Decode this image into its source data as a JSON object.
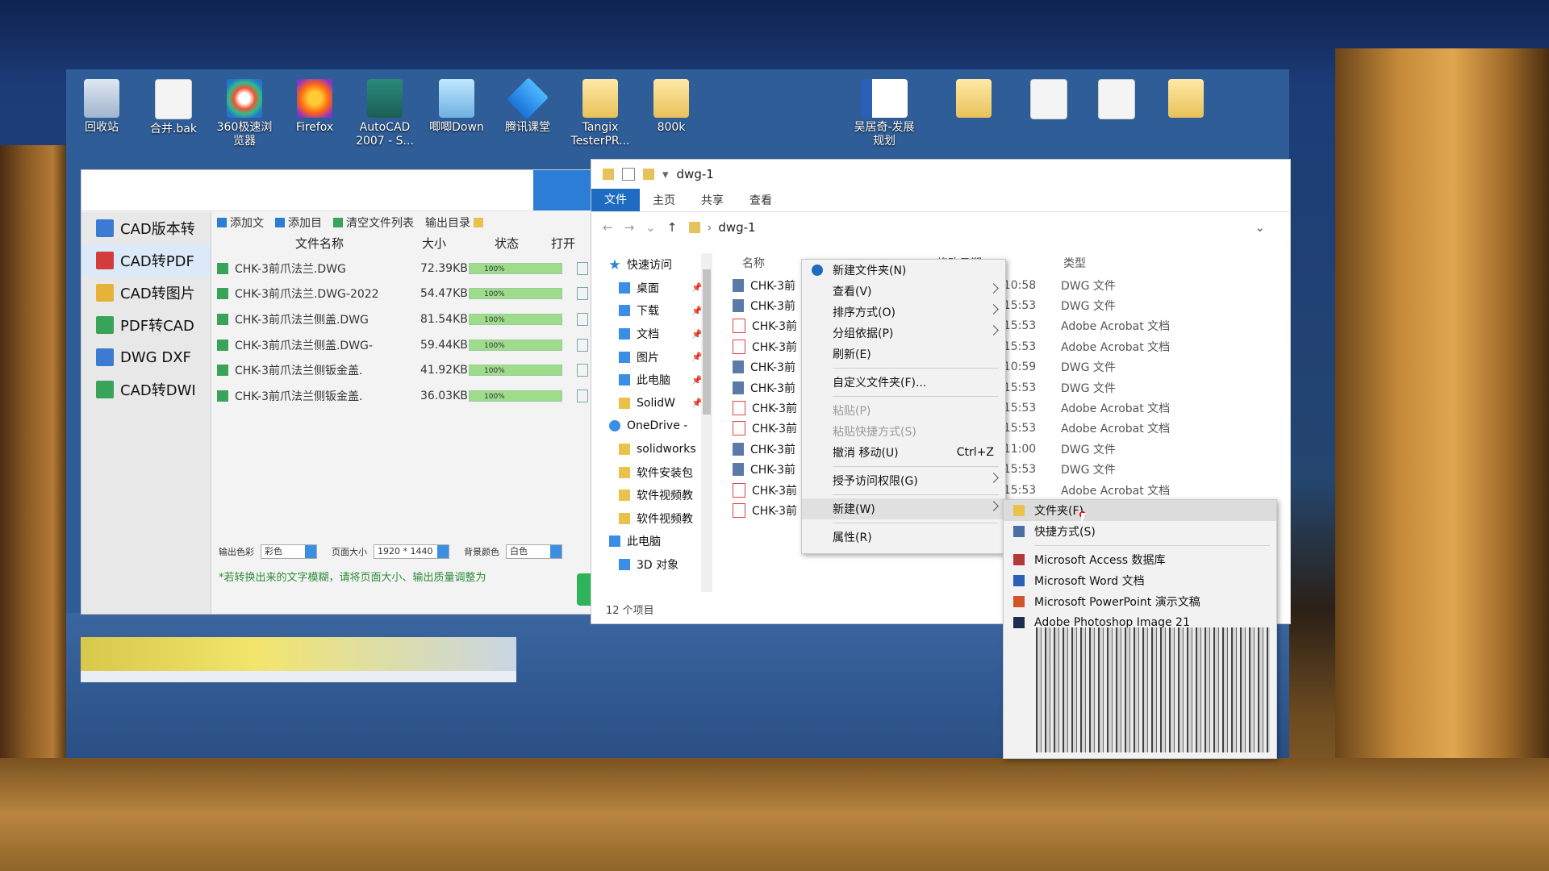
{
  "desktop": {
    "icons": [
      {
        "label": "回收站",
        "icon": "recycle-bin-icon"
      },
      {
        "label": "合并.bak",
        "icon": "file-icon"
      },
      {
        "label": "360极速浏览器",
        "icon": "browser-360-icon"
      },
      {
        "label": "Firefox",
        "icon": "firefox-icon"
      },
      {
        "label": "AutoCAD 2007 - S...",
        "icon": "autocad-icon"
      },
      {
        "label": "唧唧Down",
        "icon": "jijidown-icon"
      },
      {
        "label": "腾讯课堂",
        "icon": "tencent-classroom-icon"
      },
      {
        "label": "Tangix TesterPR...",
        "icon": "folder-icon"
      },
      {
        "label": "800k",
        "icon": "folder-icon"
      },
      {
        "label": "吴居奇-发展规划",
        "icon": "word-doc-icon"
      }
    ]
  },
  "cad_app": {
    "sidebar": [
      "CAD版本转",
      "CAD转PDF",
      "CAD转图片",
      "PDF转CAD",
      "DWG DXF",
      "CAD转DWI"
    ],
    "toolbar": {
      "add_file": "添加文",
      "add_dir": "添加目",
      "clear_list": "清空文件列表",
      "output_dir": "输出目录"
    },
    "columns": {
      "name": "文件名称",
      "size": "大小",
      "status": "状态",
      "open": "打开"
    },
    "files": [
      {
        "name": "CHK-3前爪法兰.DWG",
        "size": "72.39KB",
        "progress": "100%"
      },
      {
        "name": "CHK-3前爪法兰.DWG-2022",
        "size": "54.47KB",
        "progress": "100%"
      },
      {
        "name": "CHK-3前爪法兰侧盖.DWG",
        "size": "81.54KB",
        "progress": "100%"
      },
      {
        "name": "CHK-3前爪法兰侧盖.DWG-",
        "size": "59.44KB",
        "progress": "100%"
      },
      {
        "name": "CHK-3前爪法兰侧钣金盖.",
        "size": "41.92KB",
        "progress": "100%"
      },
      {
        "name": "CHK-3前爪法兰侧钣金盖.",
        "size": "36.03KB",
        "progress": "100%"
      }
    ],
    "options": {
      "color_label": "输出色彩",
      "color_value": "彩色",
      "page_label": "页面大小",
      "page_value": "1920 * 1440",
      "bg_label": "背景颜色",
      "bg_value": "白色"
    },
    "note": "*若转换出来的文字模糊，请将页面大小、输出质量调整为"
  },
  "explorer": {
    "title": "dwg-1",
    "tabs": [
      "文件",
      "主页",
      "共享",
      "查看"
    ],
    "path": "dwg-1",
    "nav": [
      {
        "label": "快速访问",
        "icon": "star"
      },
      {
        "label": "桌面",
        "icon": "blue",
        "pin": "📌"
      },
      {
        "label": "下载",
        "icon": "blue",
        "pin": "📌"
      },
      {
        "label": "文档",
        "icon": "blue",
        "pin": "📌"
      },
      {
        "label": "图片",
        "icon": "blue",
        "pin": "📌"
      },
      {
        "label": "此电脑",
        "icon": "blue",
        "pin": "📌"
      },
      {
        "label": "SolidW",
        "icon": "yf",
        "pin": "📌"
      },
      {
        "label": "OneDrive -",
        "icon": "cloud"
      },
      {
        "label": "solidworks",
        "icon": "yf"
      },
      {
        "label": "软件安装包",
        "icon": "yf"
      },
      {
        "label": "软件视频教",
        "icon": "yf"
      },
      {
        "label": "软件视频教",
        "icon": "yf"
      },
      {
        "label": "此电脑",
        "icon": "blue"
      },
      {
        "label": "3D 对象",
        "icon": "blue"
      }
    ],
    "columns": {
      "name": "名称",
      "date": "修改日期",
      "type": "类型"
    },
    "files": [
      {
        "name": "CHK-3前",
        "date": "2022-06-28 10:58",
        "type": "DWG 文件",
        "kind": "dwg"
      },
      {
        "name": "CHK-3前",
        "date": "2022-06-28 15:53",
        "type": "DWG 文件",
        "kind": "dwg"
      },
      {
        "name": "CHK-3前",
        "date": "2022-06-28 15:53",
        "type": "Adobe Acrobat 文档",
        "kind": "pdf"
      },
      {
        "name": "CHK-3前",
        "date": "2022-06-28 15:53",
        "type": "Adobe Acrobat 文档",
        "kind": "pdf"
      },
      {
        "name": "CHK-3前",
        "date": "2022-06-28 10:59",
        "type": "DWG 文件",
        "kind": "dwg"
      },
      {
        "name": "CHK-3前",
        "date": "2022-06-28 15:53",
        "type": "DWG 文件",
        "kind": "dwg"
      },
      {
        "name": "CHK-3前",
        "date": "2022-06-28 15:53",
        "type": "Adobe Acrobat 文档",
        "kind": "pdf"
      },
      {
        "name": "CHK-3前",
        "date": "2022-06-28 15:53",
        "type": "Adobe Acrobat 文档",
        "kind": "pdf"
      },
      {
        "name": "CHK-3前",
        "date": "2022-06-28 11:00",
        "type": "DWG 文件",
        "kind": "dwg"
      },
      {
        "name": "CHK-3前",
        "date": "2022-06-28 15:53",
        "type": "DWG 文件",
        "kind": "dwg"
      },
      {
        "name": "CHK-3前",
        "date": "2022-06-28 15:53",
        "type": "Adobe Acrobat 文档",
        "kind": "pdf"
      },
      {
        "name": "CHK-3前",
        "date": "",
        "type": "",
        "kind": "pdf"
      }
    ],
    "status": "12 个项目"
  },
  "context_menu": {
    "items": [
      {
        "label": "新建文件夹(N)",
        "icon": true
      },
      {
        "label": "查看(V)",
        "arrow": true
      },
      {
        "label": "排序方式(O)",
        "arrow": true
      },
      {
        "label": "分组依据(P)",
        "arrow": true
      },
      {
        "label": "刷新(E)"
      },
      {
        "sep": true
      },
      {
        "label": "自定义文件夹(F)..."
      },
      {
        "sep": true
      },
      {
        "label": "粘贴(P)",
        "disabled": true
      },
      {
        "label": "粘贴快捷方式(S)",
        "disabled": true
      },
      {
        "label": "撤消 移动(U)",
        "shortcut": "Ctrl+Z"
      },
      {
        "sep": true
      },
      {
        "label": "授予访问权限(G)",
        "arrow": true
      },
      {
        "sep": true
      },
      {
        "label": "新建(W)",
        "arrow": true,
        "highlight": true
      },
      {
        "sep": true
      },
      {
        "label": "属性(R)"
      }
    ]
  },
  "submenu": {
    "items": [
      {
        "label": "文件夹(F)",
        "icon": "fold",
        "highlight": true
      },
      {
        "label": "快捷方式(S)",
        "icon": "lnk"
      },
      {
        "sep": true
      },
      {
        "label": "Microsoft Access 数据库",
        "icon": "acc"
      },
      {
        "label": "Microsoft Word 文档",
        "icon": "wrd"
      },
      {
        "label": "Microsoft PowerPoint 演示文稿",
        "icon": "ppt"
      },
      {
        "label": "Adobe Photoshop Image 21",
        "icon": "ps"
      }
    ]
  }
}
